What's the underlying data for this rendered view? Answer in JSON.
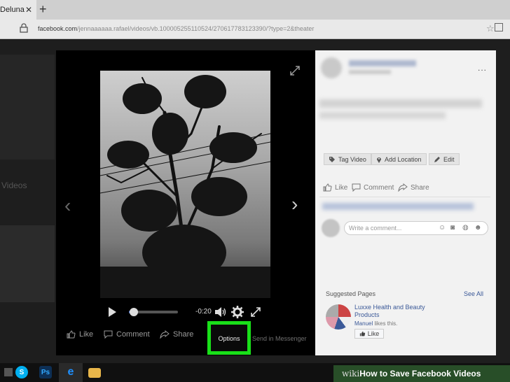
{
  "browser": {
    "tab_title": "Deluna",
    "tab_close": "✕",
    "new_tab": "+",
    "url_host": "facebook.com",
    "url_path": "/jennaaaaaa.rafael/videos/vb.100005255110524/270617783123390/?type=2&theater",
    "favorite_icon": "star-icon"
  },
  "page_background": {
    "videos_label": "Videos"
  },
  "video_player": {
    "time": "-0:20",
    "progress_fraction": 0.1,
    "prev_arrow": "‹",
    "next_arrow": "›"
  },
  "theater_actions": {
    "like": "Like",
    "comment": "Comment",
    "share": "Share",
    "options": "Options",
    "send_messenger": "Send in Messenger",
    "highlight_color": "#19e019"
  },
  "right_panel": {
    "more": "...",
    "tag_video": "Tag Video",
    "add_location": "Add Location",
    "edit": "Edit",
    "like": "Like",
    "comment": "Comment",
    "share": "Share",
    "comment_placeholder": "Write a comment...",
    "suggested_pages": "Suggested Pages",
    "see_all": "See All",
    "page_name": "Luxxe Health and Beauty Products",
    "friend_name": "Manuel",
    "friend_suffix": " likes this.",
    "page_like": "Like"
  },
  "taskbar": {
    "ps_label": "Ps",
    "skype_label": "S",
    "edge_label": "e"
  },
  "watermark": {
    "wiki": "wiki",
    "title": "How to Save Facebook Videos"
  }
}
